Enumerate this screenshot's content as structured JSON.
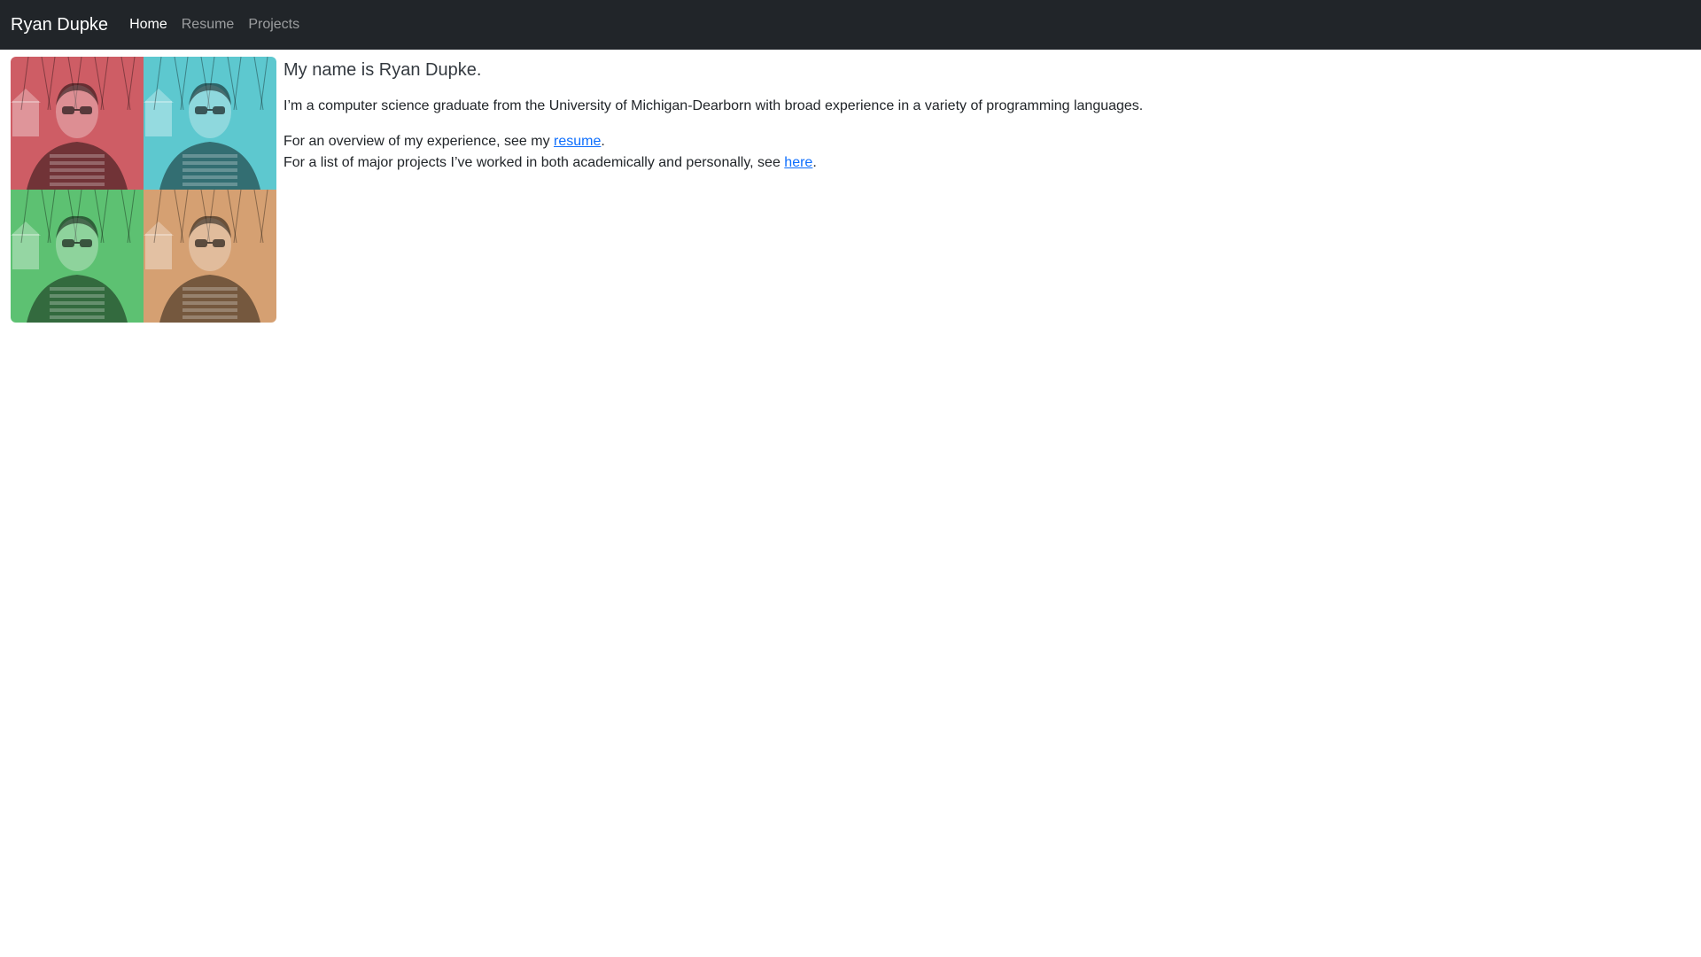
{
  "navbar": {
    "brand": "Ryan Dupke",
    "links": [
      {
        "label": "Home",
        "active": true
      },
      {
        "label": "Resume",
        "active": false
      },
      {
        "label": "Projects",
        "active": false
      }
    ]
  },
  "photo": {
    "tint_colors": [
      "#c0303a",
      "#2fb8c2",
      "#2fb04a",
      "#c9854a"
    ]
  },
  "main": {
    "headline": "My name is Ryan Dupke.",
    "intro": "I’m a computer science graduate from the University of Michigan-Dearborn with broad experience in a variety of programming languages.",
    "resume_line": {
      "prefix": "For an overview of my experience, see my ",
      "link": "resume",
      "suffix": "."
    },
    "projects_line": {
      "prefix": "For a list of major projects I’ve worked in both academically and personally, see ",
      "link": "here",
      "suffix": "."
    }
  }
}
